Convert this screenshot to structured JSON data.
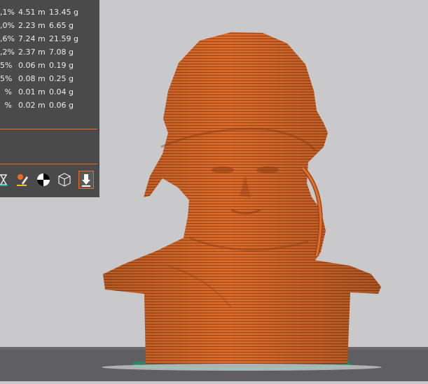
{
  "colors": {
    "accent": "#ed6b21",
    "panel": "#4a4a4a",
    "panel_text": "#ececec",
    "model": "#d9692a",
    "background": "#c9c9cb",
    "bed": "#5e5e60",
    "skirt": "#1e8f6b"
  },
  "stats": {
    "rows": [
      {
        "pct": ",1%",
        "length": "4.51 m",
        "weight": "13.45 g"
      },
      {
        "pct": ",0%",
        "length": "2.23 m",
        "weight": "6.65 g"
      },
      {
        "pct": ",6%",
        "length": "7.24 m",
        "weight": "21.59 g"
      },
      {
        "pct": ",2%",
        "length": "2.37 m",
        "weight": "7.08 g"
      },
      {
        "pct": "5%",
        "length": "0.06 m",
        "weight": "0.19 g"
      },
      {
        "pct": "5%",
        "length": "0.08 m",
        "weight": "0.25 g"
      },
      {
        "pct": "%",
        "length": "0.01 m",
        "weight": "0.04 g"
      },
      {
        "pct": "%",
        "length": "0.02 m",
        "weight": "0.06 g"
      }
    ]
  },
  "toolbar": {
    "tools": [
      {
        "name": "hourglass-icon"
      },
      {
        "name": "paint-icon"
      },
      {
        "name": "color-wheel-icon"
      },
      {
        "name": "cube-wireframe-icon"
      },
      {
        "name": "export-arrow-icon",
        "active": true
      }
    ]
  }
}
